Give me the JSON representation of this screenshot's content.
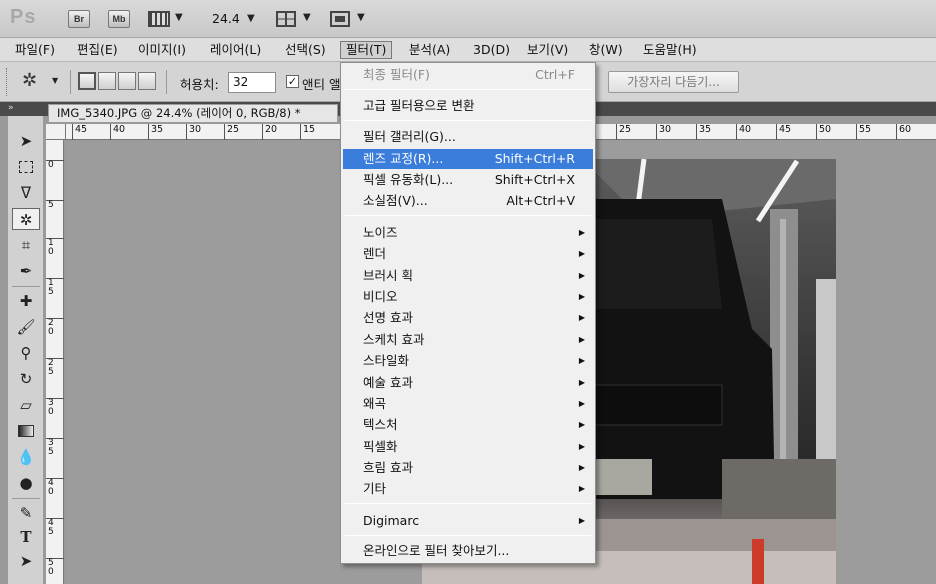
{
  "appbar": {
    "logo": "Ps",
    "br": "Br",
    "mb": "Mb",
    "zoom": "24.4"
  },
  "menubar": {
    "items": [
      "파일(F)",
      "편집(E)",
      "이미지(I)",
      "레이어(L)",
      "선택(S)",
      "필터(T)",
      "분석(A)",
      "3D(D)",
      "보기(V)",
      "창(W)",
      "도움말(H)"
    ]
  },
  "options": {
    "tolerance_label": "허용치:",
    "tolerance_value": "32",
    "antialias_label": "앤티 앨",
    "refine_button": "가장자리 다듬기..."
  },
  "document": {
    "tab_title": "IMG_5340.JPG @ 24.4% (레이어 0, RGB/8) *"
  },
  "ruler": {
    "h_labels": [
      "45",
      "40",
      "35",
      "30",
      "25",
      "20",
      "15",
      "25",
      "30",
      "35",
      "40",
      "45",
      "50",
      "55",
      "60"
    ],
    "v_labels": [
      "0",
      "5",
      "1\n0",
      "1\n5",
      "2\n0",
      "2\n5",
      "3\n0",
      "3\n5",
      "4\n0",
      "4\n5",
      "5\n0"
    ]
  },
  "filter_menu": {
    "last_filter": {
      "label": "최종 필터(F)",
      "shortcut": "Ctrl+F"
    },
    "convert": "고급 필터용으로 변환",
    "gallery": "필터 갤러리(G)...",
    "lens": {
      "label": "렌즈 교정(R)...",
      "shortcut": "Shift+Ctrl+R"
    },
    "liquify": {
      "label": "픽셀 유동화(L)...",
      "shortcut": "Shift+Ctrl+X"
    },
    "vanishing": {
      "label": "소실점(V)...",
      "shortcut": "Alt+Ctrl+V"
    },
    "submenus": [
      "노이즈",
      "렌더",
      "브러시 획",
      "비디오",
      "선명 효과",
      "스케치 효과",
      "스타일화",
      "예술 효과",
      "왜곡",
      "텍스처",
      "픽셀화",
      "흐림 효과",
      "기타"
    ],
    "digimarc": "Digimarc",
    "browse": "온라인으로 필터 찾아보기..."
  }
}
